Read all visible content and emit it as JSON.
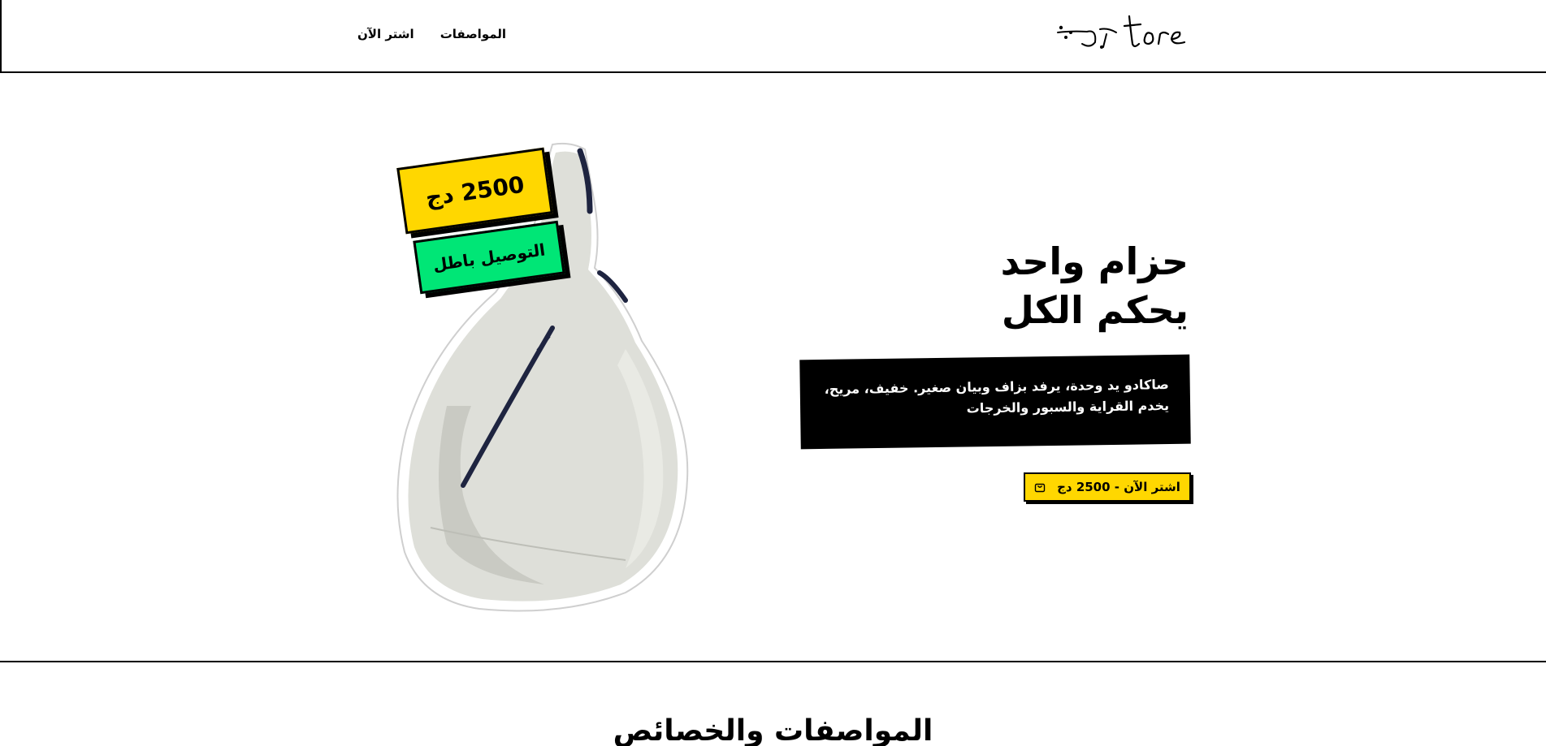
{
  "header": {
    "logo_alt": "logo",
    "nav": [
      {
        "label": "المواصفات"
      },
      {
        "label": "اشتر الآن"
      }
    ]
  },
  "hero": {
    "price_tag": "2500 دج",
    "delivery_tag": "التوصيل باطل",
    "headline_line1": "حزام واحد",
    "headline_line2": "يحكم الكل",
    "description_line1": "صاكادو يد وحدة، يرفد بزاف وبيان صغير. خفيف، مريح،",
    "description_line2": "يخدم القراية والسبور والخرجات",
    "buy_button": "اشتر الآن - 2500 دج",
    "buy_icon": "shopping-bag-icon"
  },
  "specs": {
    "title": "المواصفات والخصائص"
  },
  "colors": {
    "accent_yellow": "#ffd700",
    "accent_green": "#00e676",
    "black": "#000000",
    "white": "#ffffff",
    "bag": "#dedfd9"
  }
}
